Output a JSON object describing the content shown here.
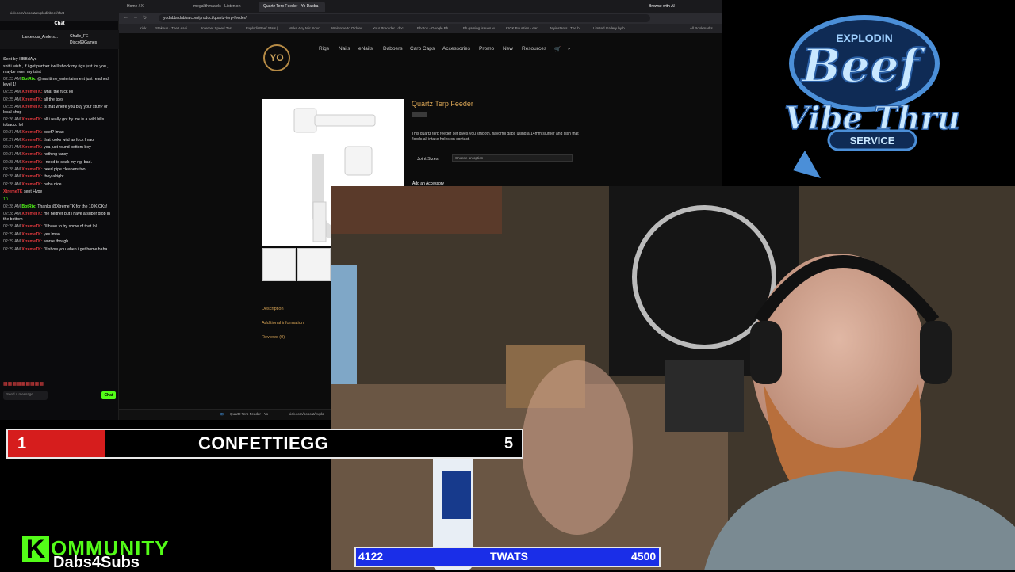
{
  "browser": {
    "tabs": [
      "Home / X",
      "megalithmavels - Listen on",
      "Quartz Terp Feeder - Yo Dabba"
    ],
    "tab_extra": "Browse with AI",
    "url": "yodabbadabba.com/product/quartz-terp-feeder/",
    "bookmarks": [
      "Kick",
      "Stakeus - The Leadi...",
      "Internet Speed Test...",
      "ExplodinBeef Stats |...",
      "Make Any Mic Soun...",
      "Welcome to Olddev...",
      "Your Preorder | doc...",
      "Photos - Google Ph...",
      "Fb gaming issues w...",
      "KICK Bounties - ear...",
      "Myinstants | The b...",
      "Limited Gallery by b..."
    ],
    "all_bookmarks": "All Bookmarks"
  },
  "site": {
    "logo": "YO",
    "nav": [
      "Rigs",
      "Nails",
      "eNails",
      "Dabbers",
      "Carb Caps",
      "Accessories",
      "Promo",
      "New",
      "Resources"
    ],
    "cart_icon": "cart-icon",
    "search_icon": "search-icon",
    "product_title": "Quartz Terp Feeder",
    "description": "This quartz terp feeder set gives you smooth, flavorful dabs using a 14mm slurper and dish that floods all intake holes on contact.",
    "joint_label": "Joint Sizes",
    "joint_placeholder": "Choose an option",
    "accessory_label": "Add an Accessory",
    "side_tabs": [
      "Description",
      "Additional information",
      "Reviews (0)"
    ]
  },
  "taskbar": {
    "items": [
      "Quartz Terp Feeder - Yo",
      "kick.com/popout/explo"
    ]
  },
  "chat": {
    "url": "kick.com/popout/explodinbeef/chat",
    "title": "Chat",
    "gifters": [
      "Larcerous_Anders...",
      "Chulle_FE",
      "Disco69Games"
    ],
    "messages": [
      {
        "time": "",
        "user": "Sent by",
        "text": "HBBdAys",
        "color": "#aaa"
      },
      {
        "time": "",
        "user": "",
        "text": "shit i wish , if i get partner i will shock my rigs just for you , maybe even my taint",
        "color": "#e8e8e8"
      },
      {
        "time": "02:23 AM",
        "user": "BotRix:",
        "text": "@maritime_entertainment just reached level 1!",
        "color": "#53fc18"
      },
      {
        "time": "02:25 AM",
        "user": "XtremeTK:",
        "text": "what the fuck lol",
        "color": "#e2393e"
      },
      {
        "time": "02:25 AM",
        "user": "XtremeTK:",
        "text": "all the toys",
        "color": "#e2393e"
      },
      {
        "time": "02:25 AM",
        "user": "XtremeTK:",
        "text": "is that where you buy your stuff? or local shop",
        "color": "#e2393e"
      },
      {
        "time": "02:26 AM",
        "user": "XtremeTK:",
        "text": "all i really got by me is a wild bills tobacco lol",
        "color": "#e2393e"
      },
      {
        "time": "02:27 AM",
        "user": "XtremeTK:",
        "text": "beef? lmao",
        "color": "#e2393e"
      },
      {
        "time": "02:27 AM",
        "user": "XtremeTK:",
        "text": "that looks wild as fuck lmao",
        "color": "#e2393e"
      },
      {
        "time": "02:27 AM",
        "user": "XtremeTK:",
        "text": "yea just round bottom boy",
        "color": "#e2393e"
      },
      {
        "time": "02:27 AM",
        "user": "XtremeTK:",
        "text": "nothing fancy",
        "color": "#e2393e"
      },
      {
        "time": "02:28 AM",
        "user": "XtremeTK:",
        "text": "i need to soak my rig, bad.",
        "color": "#e2393e"
      },
      {
        "time": "02:28 AM",
        "user": "XtremeTK:",
        "text": "need pipe cleaners too",
        "color": "#e2393e"
      },
      {
        "time": "02:28 AM",
        "user": "XtremeTK:",
        "text": "they alright",
        "color": "#e2393e"
      },
      {
        "time": "02:28 AM",
        "user": "XtremeTK:",
        "text": "haha nice",
        "color": "#e2393e"
      },
      {
        "time": "",
        "user": "XtremeTK",
        "text": "sent Hype",
        "color": "#e2393e"
      },
      {
        "time": "",
        "user": "",
        "text": "10",
        "color": "#53fc18"
      },
      {
        "time": "02:28 AM",
        "user": "BotRix:",
        "text": "Thanks @XtremeTK for the 10 KICKs!",
        "color": "#53fc18"
      },
      {
        "time": "02:28 AM",
        "user": "XtremeTK:",
        "text": "me neither but i have a super glob in the bottom",
        "color": "#e2393e"
      },
      {
        "time": "02:28 AM",
        "user": "XtremeTK:",
        "text": "i'll have to try some of that lol",
        "color": "#e2393e"
      },
      {
        "time": "02:29 AM",
        "user": "XtremeTK:",
        "text": "yes lmao",
        "color": "#e2393e"
      },
      {
        "time": "02:29 AM",
        "user": "XtremeTK:",
        "text": "worse though",
        "color": "#e2393e"
      },
      {
        "time": "02:29 AM",
        "user": "XtremeTK:",
        "text": "i'll show you when i get home haha",
        "color": "#e2393e"
      }
    ],
    "input_placeholder": "Send a message",
    "send_label": "Chat"
  },
  "overlay": {
    "top_bar": {
      "left": "1",
      "name": "CONFETTIEGG",
      "right": "5",
      "fill_fraction": 0.19,
      "fill_color": "#d61d1d"
    },
    "bottom_bar": {
      "left": "4122",
      "name": "TWATS",
      "right": "4500",
      "color": "#1a2ee8"
    },
    "kommunity_k": "K",
    "kommunity": "OMMUNITY",
    "dabs4subs": "Dabs4Subs",
    "logo_top": "EXPLODIN",
    "logo_mid": "Beef",
    "logo_main": "Vibe Thru",
    "logo_sub": "SERVICE"
  }
}
